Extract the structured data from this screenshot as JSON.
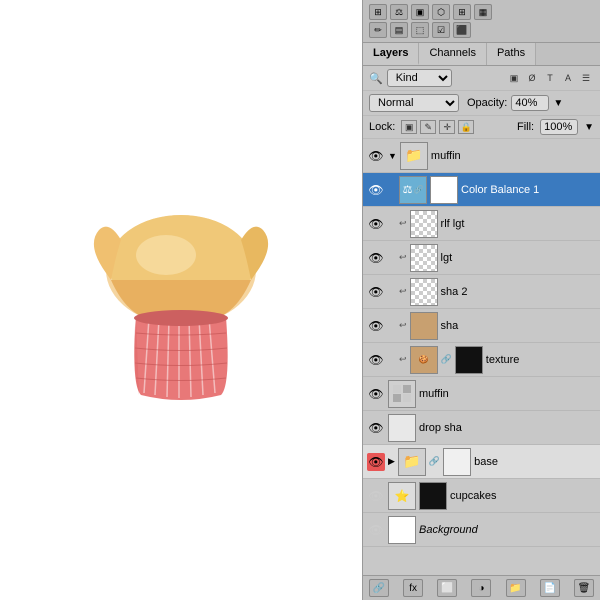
{
  "toolbar": {
    "icons_row1": [
      "⊞",
      "⚖",
      "▣",
      "⬡",
      "⊞",
      "▦"
    ],
    "icons_row2": [
      "✏",
      "▤",
      "⬚",
      "☑",
      "⬛",
      "▥"
    ]
  },
  "tabs": [
    {
      "label": "Layers",
      "active": true
    },
    {
      "label": "Channels",
      "active": false
    },
    {
      "label": "Paths",
      "active": false
    }
  ],
  "kind_row": {
    "label": "Kind",
    "kind_value": "Kind",
    "icons": [
      "▣",
      "Ø",
      "T",
      "A",
      "☰"
    ]
  },
  "blend_row": {
    "blend_label": "Normal",
    "opacity_label": "Opacity:",
    "opacity_value": "40%"
  },
  "lock_row": {
    "lock_label": "Lock:",
    "lock_icons": [
      "▣",
      "✎",
      "✛",
      "🔒"
    ],
    "fill_label": "Fill:",
    "fill_value": "100%"
  },
  "layers": [
    {
      "name": "muffin",
      "type": "group",
      "visible": true,
      "selected": false,
      "indent": 0,
      "thumb_type": "folder",
      "has_eye": true,
      "has_arrow": true
    },
    {
      "name": "Color Balance 1",
      "type": "adjustment",
      "visible": true,
      "selected": true,
      "indent": 1,
      "thumb_type": "adjustment",
      "has_eye": true,
      "has_chain": true,
      "has_white_thumb": true
    },
    {
      "name": "rlf lgt",
      "type": "layer",
      "visible": true,
      "selected": false,
      "indent": 1,
      "thumb_type": "checker",
      "has_eye": true
    },
    {
      "name": "lgt",
      "type": "layer",
      "visible": true,
      "selected": false,
      "indent": 1,
      "thumb_type": "checker",
      "has_eye": true
    },
    {
      "name": "sha 2",
      "type": "layer",
      "visible": true,
      "selected": false,
      "indent": 1,
      "thumb_type": "checker",
      "has_eye": true
    },
    {
      "name": "sha",
      "type": "layer",
      "visible": true,
      "selected": false,
      "indent": 1,
      "thumb_type": "tan",
      "has_eye": true
    },
    {
      "name": "texture",
      "type": "layer",
      "visible": true,
      "selected": false,
      "indent": 1,
      "thumb_type": "tan_small",
      "has_eye": true,
      "has_chain": true,
      "has_black_thumb": true
    },
    {
      "name": "muffin",
      "type": "group2",
      "visible": true,
      "selected": false,
      "indent": 0,
      "thumb_type": "grid",
      "has_eye": true,
      "has_arrow": false
    },
    {
      "name": "drop sha",
      "type": "layer",
      "visible": true,
      "selected": false,
      "indent": 0,
      "thumb_type": "white",
      "has_eye": true
    },
    {
      "name": "base",
      "type": "group",
      "visible": true,
      "selected": false,
      "indent": 0,
      "thumb_type": "folder_chain",
      "has_eye": true,
      "has_arrow": true,
      "red_eye": true
    },
    {
      "name": "cupcakes",
      "type": "layer",
      "visible": false,
      "selected": false,
      "indent": 0,
      "thumb_type": "star",
      "has_eye": false,
      "has_black_square": true
    },
    {
      "name": "Background",
      "type": "layer",
      "visible": true,
      "selected": false,
      "indent": 0,
      "thumb_type": "white",
      "has_eye": false,
      "italic": true
    }
  ],
  "bottom_toolbar": {
    "icons": [
      "⊞",
      "✦",
      "▣",
      "▤",
      "🗑"
    ]
  }
}
